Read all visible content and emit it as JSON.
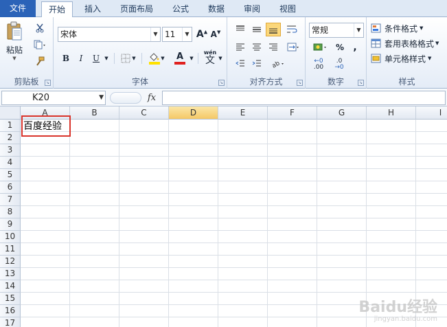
{
  "tabs": [
    {
      "label": "文件",
      "kind": "file"
    },
    {
      "label": "开始",
      "kind": "active"
    },
    {
      "label": "插入",
      "kind": "normal"
    },
    {
      "label": "页面布局",
      "kind": "normal"
    },
    {
      "label": "公式",
      "kind": "normal"
    },
    {
      "label": "数据",
      "kind": "normal"
    },
    {
      "label": "审阅",
      "kind": "normal"
    },
    {
      "label": "视图",
      "kind": "normal"
    }
  ],
  "clipboard": {
    "paste_label": "粘贴",
    "group_label": "剪贴板"
  },
  "font": {
    "name": "宋体",
    "size": "11",
    "group_label": "字体",
    "bold": "B",
    "italic": "I",
    "underline": "U",
    "font_color_glyph": "A",
    "wen_glyph": "wén"
  },
  "alignment": {
    "group_label": "对齐方式"
  },
  "number": {
    "format": "常规",
    "group_label": "数字",
    "percent": "%",
    "comma": ",",
    "inc_decimal": ".00",
    "dec_decimal": ".0"
  },
  "styles": {
    "group_label": "样式",
    "conditional": "条件格式",
    "table_format": "套用表格格式",
    "cell_styles": "单元格样式"
  },
  "formula_bar": {
    "name_box": "K20",
    "fx": "fx",
    "value": ""
  },
  "grid": {
    "columns": [
      "A",
      "B",
      "C",
      "D",
      "E",
      "F",
      "G",
      "H",
      "I"
    ],
    "selected_column": "D",
    "rows": [
      "1",
      "2",
      "3",
      "4",
      "5",
      "6",
      "7",
      "8",
      "9",
      "10",
      "11",
      "12",
      "13",
      "14",
      "15",
      "16",
      "17"
    ],
    "cell_a1": "百度经验"
  },
  "watermark": {
    "text": "Baidu经验",
    "sub": "jingyan.baidu.com"
  },
  "colors": {
    "file_tab": "#2b63b8",
    "highlight": "#d9342b",
    "selected_col": "#f5c866"
  }
}
